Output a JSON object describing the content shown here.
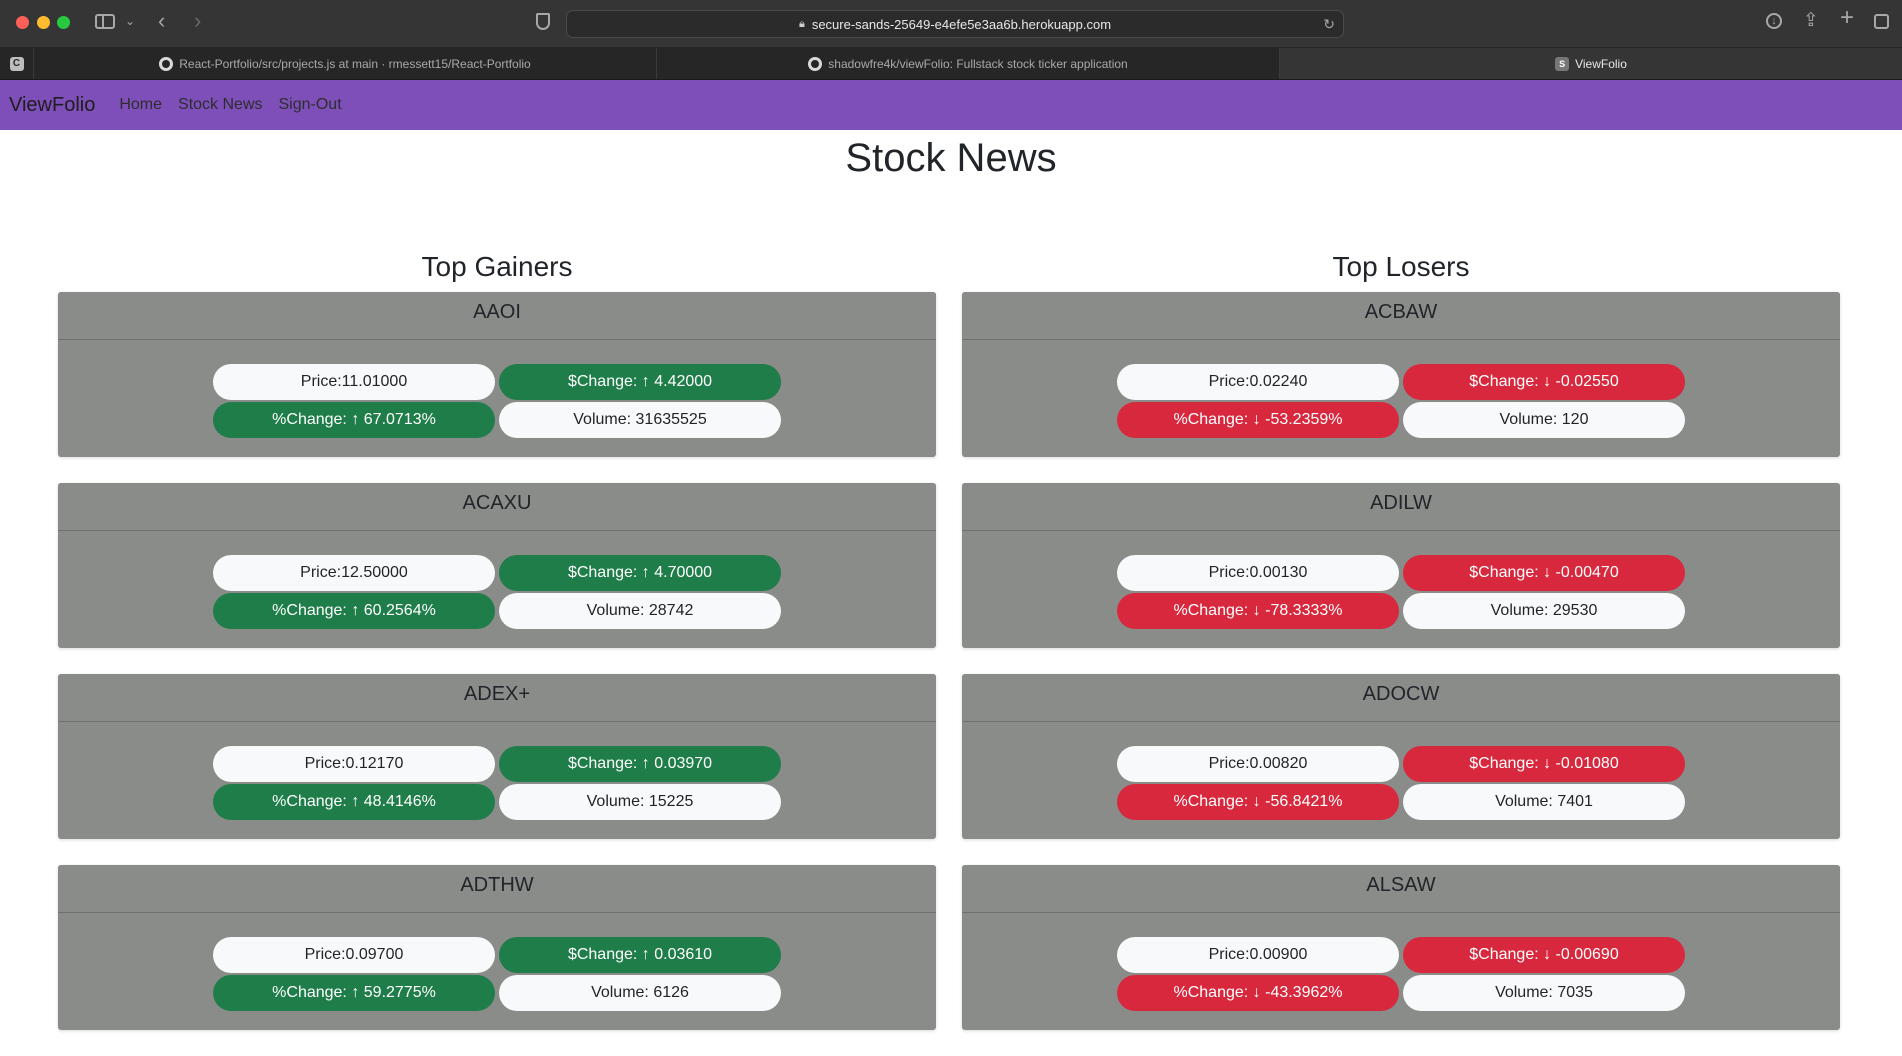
{
  "browser": {
    "url": "secure-sands-25649-e4efe5e3aa6b.herokuapp.com",
    "tabs": [
      {
        "title": "React-Portfolio/src/projects.js at main · rmessett15/React-Portfolio",
        "icon": "github-icon"
      },
      {
        "title": "shadowfre4k/viewFolio: Fullstack stock ticker application",
        "icon": "github-icon"
      },
      {
        "title": "ViewFolio",
        "icon": "s-favicon-icon"
      }
    ],
    "pinned_tab_letter": "C"
  },
  "nav": {
    "brand": "ViewFolio",
    "links": [
      "Home",
      "Stock News",
      "Sign-Out"
    ]
  },
  "page": {
    "title": "Stock News"
  },
  "colors": {
    "navbar": "#7e4fb9",
    "gain": "#1e7d48",
    "loss": "#d7283d",
    "card": "#8a8c89"
  },
  "gainers": {
    "heading": "Top Gainers",
    "items": [
      {
        "ticker": "AAOI",
        "price": "Price:11.01000",
        "change": "$Change: ↑ 4.42000",
        "pct": "%Change: ↑ 67.0713%",
        "volume": "Volume: 31635525"
      },
      {
        "ticker": "ACAXU",
        "price": "Price:12.50000",
        "change": "$Change: ↑ 4.70000",
        "pct": "%Change: ↑ 60.2564%",
        "volume": "Volume: 28742"
      },
      {
        "ticker": "ADEX+",
        "price": "Price:0.12170",
        "change": "$Change: ↑ 0.03970",
        "pct": "%Change: ↑ 48.4146%",
        "volume": "Volume: 15225"
      },
      {
        "ticker": "ADTHW",
        "price": "Price:0.09700",
        "change": "$Change: ↑ 0.03610",
        "pct": "%Change: ↑ 59.2775%",
        "volume": "Volume: 6126"
      }
    ]
  },
  "losers": {
    "heading": "Top Losers",
    "items": [
      {
        "ticker": "ACBAW",
        "price": "Price:0.02240",
        "change": "$Change: ↓ -0.02550",
        "pct": "%Change: ↓ -53.2359%",
        "volume": "Volume: 120"
      },
      {
        "ticker": "ADILW",
        "price": "Price:0.00130",
        "change": "$Change: ↓ -0.00470",
        "pct": "%Change: ↓ -78.3333%",
        "volume": "Volume: 29530"
      },
      {
        "ticker": "ADOCW",
        "price": "Price:0.00820",
        "change": "$Change: ↓ -0.01080",
        "pct": "%Change: ↓ -56.8421%",
        "volume": "Volume: 7401"
      },
      {
        "ticker": "ALSAW",
        "price": "Price:0.00900",
        "change": "$Change: ↓ -0.00690",
        "pct": "%Change: ↓ -43.3962%",
        "volume": "Volume: 7035"
      }
    ]
  }
}
